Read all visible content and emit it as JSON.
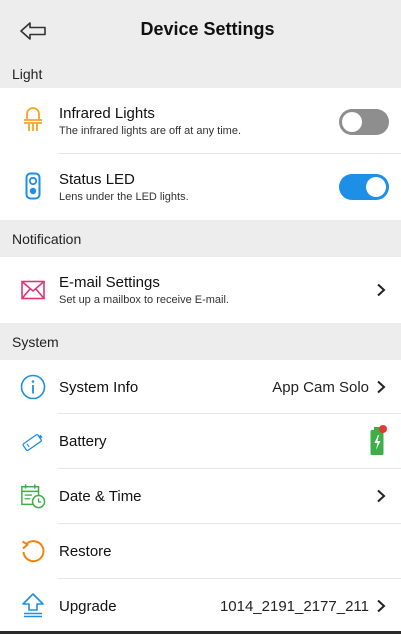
{
  "header": {
    "title": "Device Settings",
    "back_icon": "back-arrow-icon"
  },
  "sections": {
    "light": "Light",
    "notification": "Notification",
    "system": "System"
  },
  "rows": {
    "infrared": {
      "title": "Infrared Lights",
      "subtitle": "The infrared lights are off at any time.",
      "icon": "infrared-light-icon",
      "enabled": false
    },
    "status_led": {
      "title": "Status LED",
      "subtitle": "Lens under the LED lights.",
      "icon": "status-led-icon",
      "enabled": true
    },
    "email": {
      "title": "E-mail Settings",
      "subtitle": "Set up a mailbox to receive E-mail.",
      "icon": "mail-icon"
    },
    "system_info": {
      "title": "System Info",
      "value": "App Cam Solo",
      "icon": "info-icon"
    },
    "battery": {
      "title": "Battery",
      "icon": "battery-icon"
    },
    "datetime": {
      "title": "Date & Time",
      "icon": "calendar-clock-icon"
    },
    "restore": {
      "title": "Restore",
      "icon": "restore-icon"
    },
    "upgrade": {
      "title": "Upgrade",
      "value": "1014_2191_2177_211",
      "icon": "upgrade-icon"
    }
  },
  "colors": {
    "accent_blue": "#1e8fe6",
    "icon_orange": "#f5a623",
    "icon_pink": "#e0357a",
    "icon_green": "#3fae49",
    "badge_red": "#e53935",
    "section_bg": "#ededed",
    "toggle_off": "#8e8e8e"
  }
}
